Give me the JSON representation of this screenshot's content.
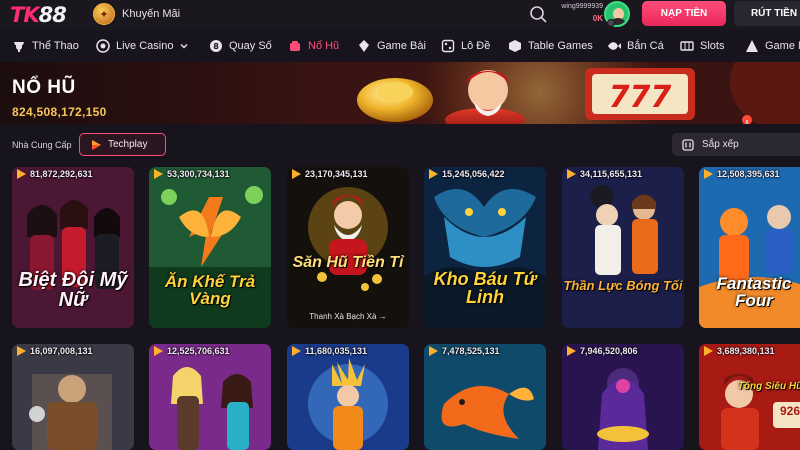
{
  "brand": {
    "logo_text": "TK88"
  },
  "header": {
    "promo_label": "Khuyến Mãi",
    "username": "wing9999939",
    "balance": "0K",
    "deposit_label": "NẠP TIỀN",
    "withdraw_label": "RÚT TIỀN"
  },
  "nav": {
    "items": [
      {
        "label": "Thể Thao",
        "icon": "sports-icon"
      },
      {
        "label": "Live Casino",
        "icon": "live-casino-icon"
      },
      {
        "label": "Quay Số",
        "icon": "lottery-icon"
      },
      {
        "label": "Nổ Hũ",
        "icon": "slot-jar-icon",
        "active": true
      },
      {
        "label": "Game Bài",
        "icon": "card-game-icon"
      },
      {
        "label": "Lô Đề",
        "icon": "lo-de-icon"
      },
      {
        "label": "Table Games",
        "icon": "table-games-icon"
      },
      {
        "label": "Bắn Cá",
        "icon": "fish-icon"
      },
      {
        "label": "Slots",
        "icon": "slots-icon"
      },
      {
        "label": "Game N",
        "icon": "game-icon"
      }
    ]
  },
  "banner": {
    "title": "NỔ HŨ",
    "amount": "824,508,172,150"
  },
  "filter": {
    "provider_label": "Nhà Cung Cấp",
    "provider_chip": "Techplay",
    "sort_label": "Sắp xếp"
  },
  "games": [
    {
      "jackpot": "81,872,292,631",
      "title": "Biệt Đội Mỹ Nữ"
    },
    {
      "jackpot": "53,300,734,131",
      "title": "Ăn Khế Trả Vàng"
    },
    {
      "jackpot": "23,170,345,131",
      "title": "Săn Hũ Tiền Tỉ",
      "subtitle": "Thanh Xà Bạch Xà →"
    },
    {
      "jackpot": "15,245,056,422",
      "title": "Kho Báu Tứ Linh"
    },
    {
      "jackpot": "34,115,655,131",
      "title": "Thần Lực Bóng Tối"
    },
    {
      "jackpot": "12,508,395,631",
      "title": "Fantastic Four"
    },
    {
      "jackpot": "16,097,008,131",
      "title": ""
    },
    {
      "jackpot": "12,525,706,631",
      "title": ""
    },
    {
      "jackpot": "11,680,035,131",
      "title": ""
    },
    {
      "jackpot": "7,478,525,131",
      "title": ""
    },
    {
      "jackpot": "7,946,520,806",
      "title": ""
    },
    {
      "jackpot": "3,689,380,131",
      "title": "Tống Siêu Hũ",
      "badge": "926"
    }
  ]
}
